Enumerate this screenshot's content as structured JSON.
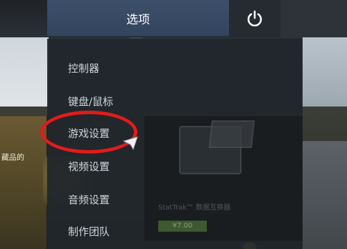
{
  "header": {
    "options_tab_label": "选项"
  },
  "menu": {
    "items": [
      {
        "label": "控制器"
      },
      {
        "label": "键盘/鼠标"
      },
      {
        "label": "游戏设置"
      },
      {
        "label": "视频设置"
      },
      {
        "label": "音频设置"
      },
      {
        "label": "制作团队"
      }
    ]
  },
  "background": {
    "left_text": "藏品的",
    "caption": "StatTrak™ 数据互换器",
    "price": "¥7.00"
  },
  "colors": {
    "tab_active": "#3d4f6a",
    "menu_bg": "#21262c",
    "menu_text": "#cfd6de",
    "annotation": "#e21b1b"
  },
  "icons": {
    "power": "power-icon",
    "cursor": "cursor-icon"
  }
}
